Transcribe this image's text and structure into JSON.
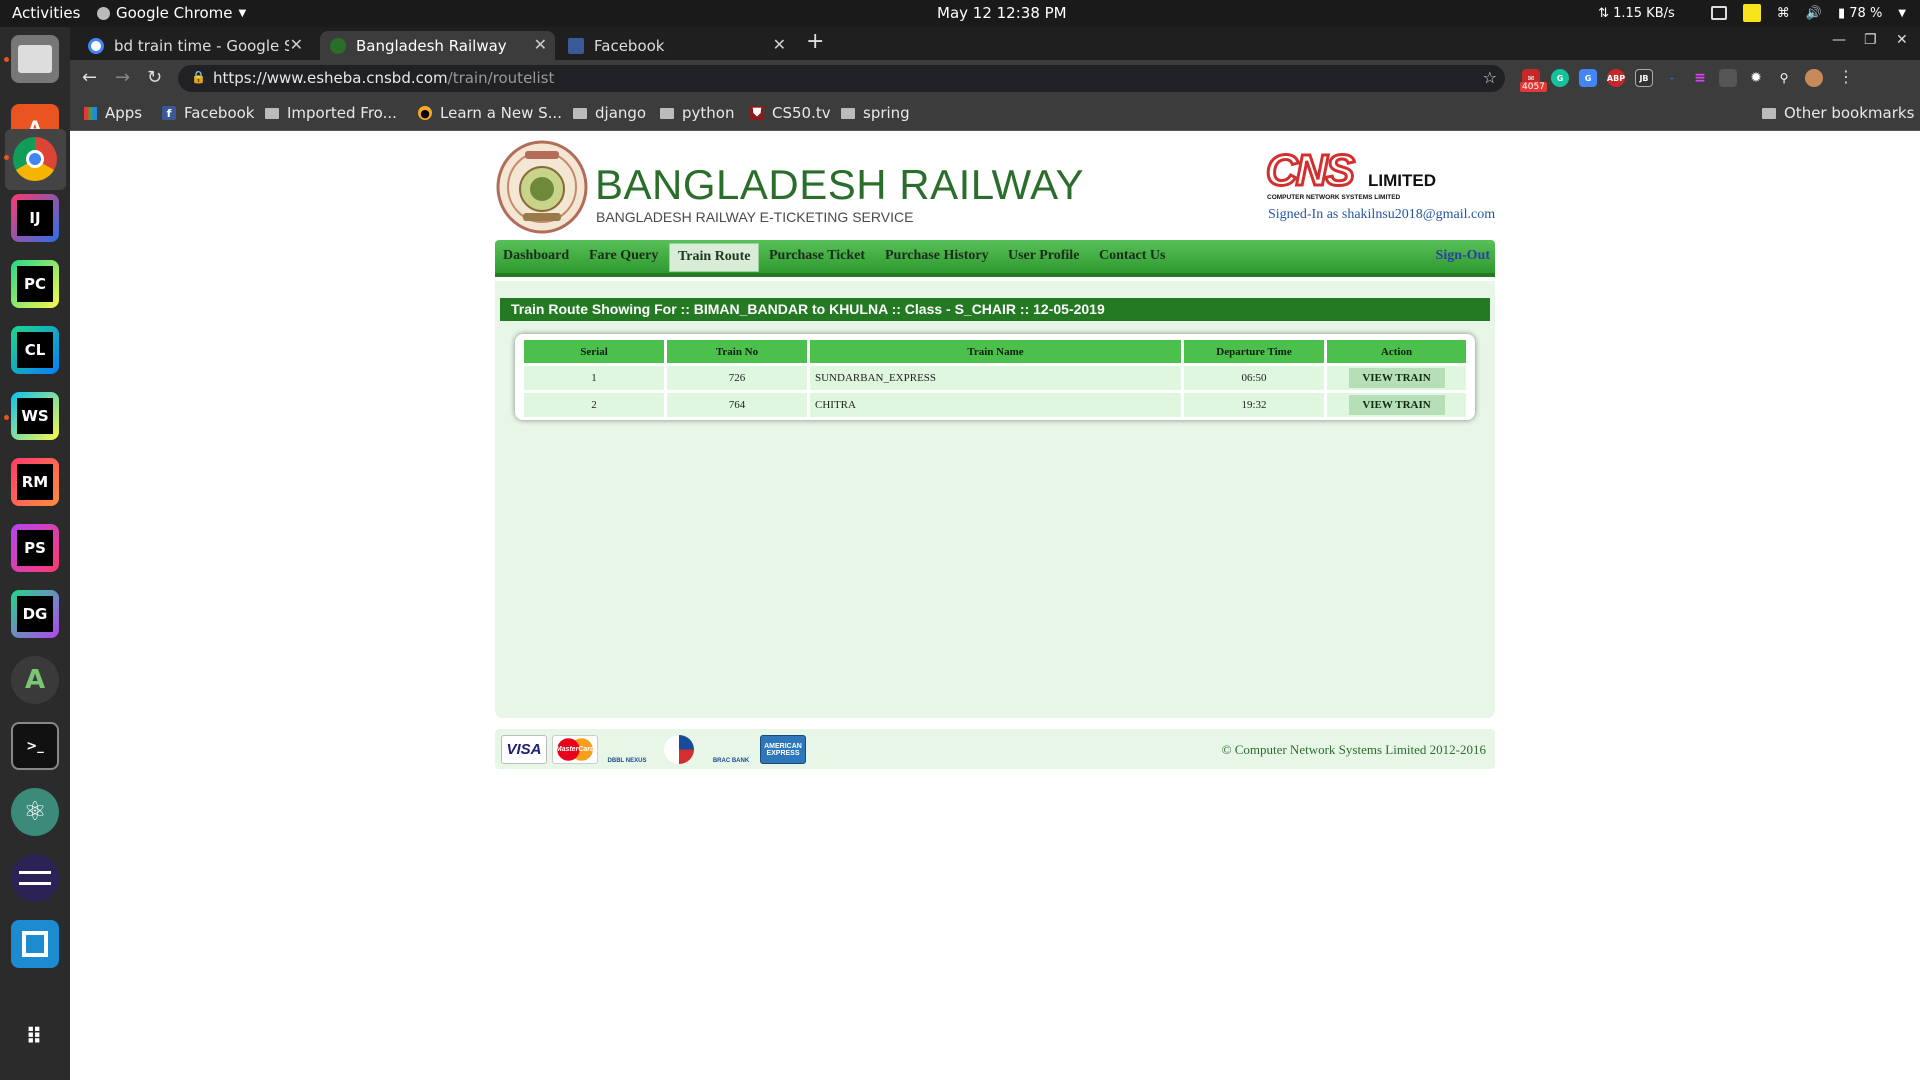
{
  "system": {
    "activities": "Activities",
    "app_name": "Google Chrome",
    "clock": "May 12  12:38 PM",
    "net_speed": "1.15 KB/s",
    "battery": "78 %"
  },
  "browser": {
    "tabs": [
      {
        "title": "bd train time - Google Sea",
        "favicon": "google-icon"
      },
      {
        "title": "Bangladesh Railway",
        "favicon": "railway-icon"
      },
      {
        "title": "Facebook",
        "favicon": "facebook-icon"
      }
    ],
    "url_host": "https://www.esheba.cnsbd.com",
    "url_path": "/train/routelist",
    "ext_badge": "4057",
    "bookmarks": [
      {
        "label": "Apps",
        "icon": "apps-grid-icon"
      },
      {
        "label": "Facebook",
        "icon": "facebook-icon"
      },
      {
        "label": "Imported Fro...",
        "icon": "folder-icon"
      },
      {
        "label": "Learn a New S...",
        "icon": "learn-icon"
      },
      {
        "label": "django",
        "icon": "folder-icon"
      },
      {
        "label": "python",
        "icon": "folder-icon"
      },
      {
        "label": "CS50.tv",
        "icon": "cs50-icon"
      },
      {
        "label": "spring",
        "icon": "folder-icon"
      }
    ],
    "other_bookmarks": "Other bookmarks"
  },
  "site": {
    "title": "BANGLADESH RAILWAY",
    "subtitle": "BANGLADESH RAILWAY E-TICKETING SERVICE",
    "partner_logo_text": "CNS",
    "partner_limited": "LIMITED",
    "partner_caption": "COMPUTER NETWORK SYSTEMS LIMITED",
    "signed_in": "Signed-In as shakilnsu2018@gmail.com",
    "menu": [
      "Dashboard",
      "Fare Query",
      "Train Route",
      "Purchase Ticket",
      "Purchase History",
      "User Profile",
      "Contact Us"
    ],
    "menu_active": "Train Route",
    "signout": "Sign-Out",
    "route_heading": "Train Route Showing For :: BIMAN_BANDAR to KHULNA :: Class - S_CHAIR :: 12-05-2019",
    "table": {
      "headers": [
        "Serial",
        "Train No",
        "Train Name",
        "Departure Time",
        "Action"
      ],
      "rows": [
        {
          "serial": "1",
          "train_no": "726",
          "name": "SUNDARBAN_EXPRESS",
          "departure": "06:50",
          "action": "VIEW TRAIN"
        },
        {
          "serial": "2",
          "train_no": "764",
          "name": "CHITRA",
          "departure": "19:32",
          "action": "VIEW TRAIN"
        }
      ]
    },
    "payments": {
      "visa": "VISA",
      "mastercard": "MasterCard",
      "dbbl": "DBBL NEXUS",
      "brac": "BRAC BANK",
      "amex": "AMERICAN EXPRESS"
    },
    "copyright": "© Computer Network Systems Limited 2012-2016"
  },
  "colors": {
    "brand_green": "#2b6e2b",
    "menu_green": "#2f9a2f",
    "content_bg": "#e8f6e8",
    "header_cell": "#4cc04c",
    "link_blue": "#2455a4"
  }
}
